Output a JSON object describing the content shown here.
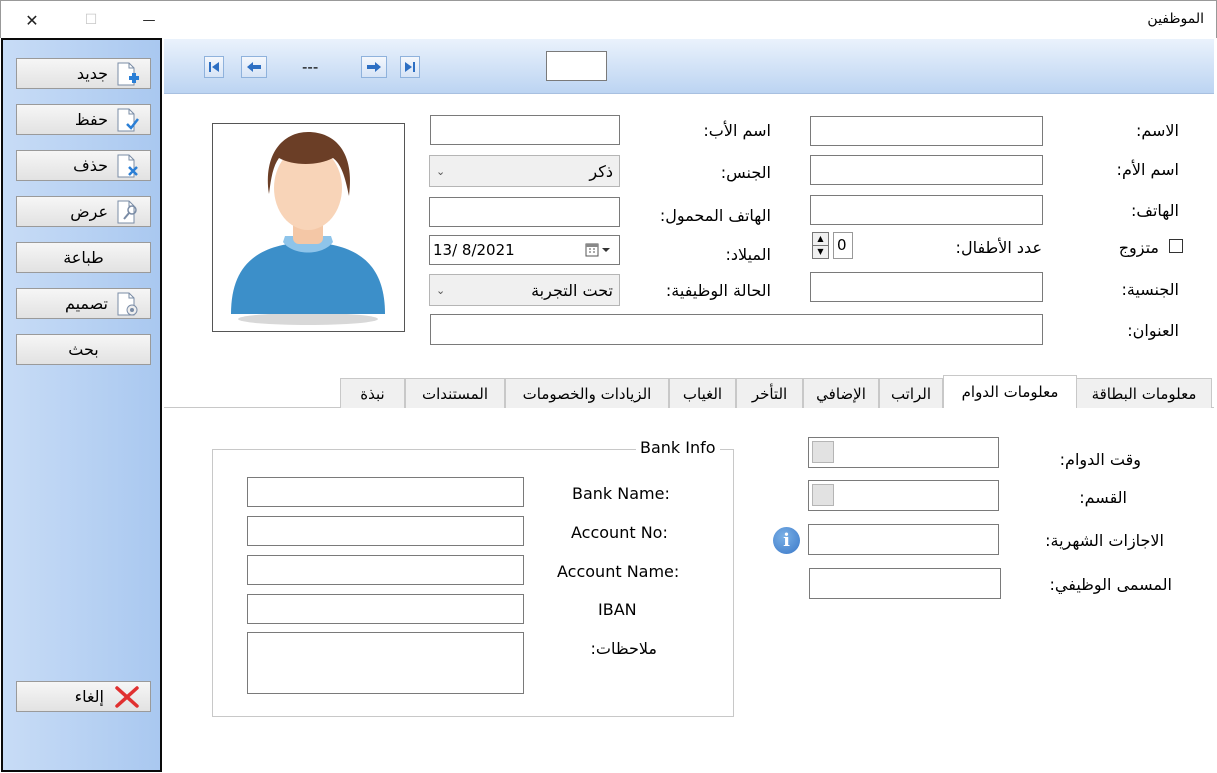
{
  "window": {
    "title": "الموظفين",
    "close_glyph": "✕",
    "maximize_glyph": "☐",
    "minimize_glyph": "—"
  },
  "toolbar": {
    "buttons": [
      {
        "label": "جديد",
        "icon": "new-document-icon"
      },
      {
        "label": "حفظ",
        "icon": "save-document-icon"
      },
      {
        "label": "حذف",
        "icon": "delete-document-icon"
      },
      {
        "label": "عرض",
        "icon": "view-document-icon"
      },
      {
        "label": "طباعة",
        "icon": ""
      },
      {
        "label": "تصميم",
        "icon": "design-document-icon"
      },
      {
        "label": "بحث",
        "icon": ""
      }
    ],
    "cancel_label": "إلغاء"
  },
  "navigation": {
    "record_text": "---",
    "record_number": ""
  },
  "employee": {
    "labels": {
      "name": "الاسم:",
      "father_name": "اسم الأب:",
      "mother_name": "اسم الأم:",
      "gender": "الجنس:",
      "phone": "الهاتف:",
      "mobile": "الهاتف المحمول:",
      "married": "متزوج",
      "children": "عدد الأطفال:",
      "birth_date": "الميلاد:",
      "nationality": "الجنسية:",
      "job_status": "الحالة الوظيفية:",
      "address": "العنوان:"
    },
    "values": {
      "gender": "ذكر",
      "children": "0",
      "birth_date": "13/  8/2021",
      "job_status": "تحت التجربة"
    }
  },
  "tabs": [
    {
      "label": "معلومات البطاقة",
      "active": false
    },
    {
      "label": "معلومات الدوام",
      "active": true
    },
    {
      "label": "الراتب",
      "active": false
    },
    {
      "label": "الإضافي",
      "active": false
    },
    {
      "label": "التأخر",
      "active": false
    },
    {
      "label": "الغياب",
      "active": false
    },
    {
      "label": "الزيادات والخصومات",
      "active": false
    },
    {
      "label": "المستندات",
      "active": false
    },
    {
      "label": "نبذة",
      "active": false
    }
  ],
  "work_info": {
    "labels": {
      "work_time": "وقت الدوام:",
      "department": "القسم:",
      "monthly_leave": "الاجازات الشهرية:",
      "job_title": "المسمى الوظيفي:"
    }
  },
  "bank_info": {
    "title": "Bank Info",
    "labels": {
      "bank_name": "Bank Name:",
      "account_no": "Account No:",
      "account_name": "Account Name:",
      "iban": "IBAN",
      "notes": "ملاحظات:"
    }
  },
  "colors": {
    "panel_blue": "#a9c8f0",
    "nav_blue": "#bcd4f2",
    "info_blue": "#3a78c8",
    "delete_red": "#e03030"
  }
}
